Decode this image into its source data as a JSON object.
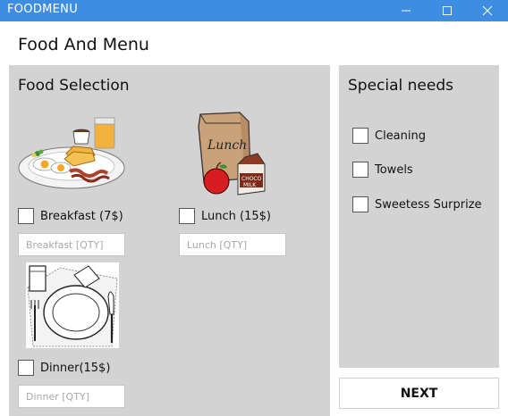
{
  "window": {
    "title": "FOODMENU",
    "controls": {
      "minimize": "minimize-icon",
      "maximize": "maximize-icon",
      "close": "close-icon"
    },
    "titlebar_color": "#3d8ee3"
  },
  "page": {
    "title": "Food And Menu"
  },
  "food_selection": {
    "title": "Food Selection",
    "items": [
      {
        "image": "breakfast-plate-image",
        "label": "Breakfast (7$)",
        "checked": false,
        "qty_value": "",
        "qty_placeholder": "Breakfast [QTY]"
      },
      {
        "image": "lunch-bag-image",
        "label": "Lunch (15$)",
        "checked": false,
        "qty_value": "",
        "qty_placeholder": "Lunch [QTY]"
      },
      {
        "image": "dinner-plate-image",
        "label": "Dinner(15$)",
        "checked": false,
        "qty_value": "",
        "qty_placeholder": "Dinner [QTY]"
      }
    ]
  },
  "special_needs": {
    "title": "Special needs",
    "items": [
      {
        "label": "Cleaning",
        "checked": false
      },
      {
        "label": "Towels",
        "checked": false
      },
      {
        "label": "Sweetess Surprize",
        "checked": false
      }
    ]
  },
  "actions": {
    "next_label": "NEXT"
  },
  "colors": {
    "panel_bg": "#d3d3d3",
    "window_bg": "#ffffff"
  }
}
